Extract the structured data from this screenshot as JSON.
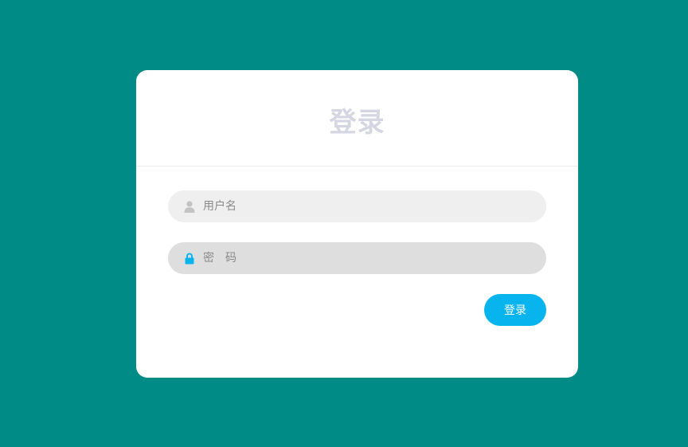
{
  "login": {
    "title": "登录",
    "username": {
      "placeholder": "用户名",
      "value": "",
      "icon": "user-icon"
    },
    "password": {
      "placeholder": "密　码",
      "value": "",
      "icon": "lock-icon"
    },
    "submit_label": "登录"
  },
  "colors": {
    "background": "#018b87",
    "card": "#ffffff",
    "title": "#d6d6e2",
    "username_field": "#efefef",
    "password_field": "#dedede",
    "button": "#07b4ee",
    "lock_icon": "#07b4ee",
    "user_icon": "#c3c3c3"
  }
}
